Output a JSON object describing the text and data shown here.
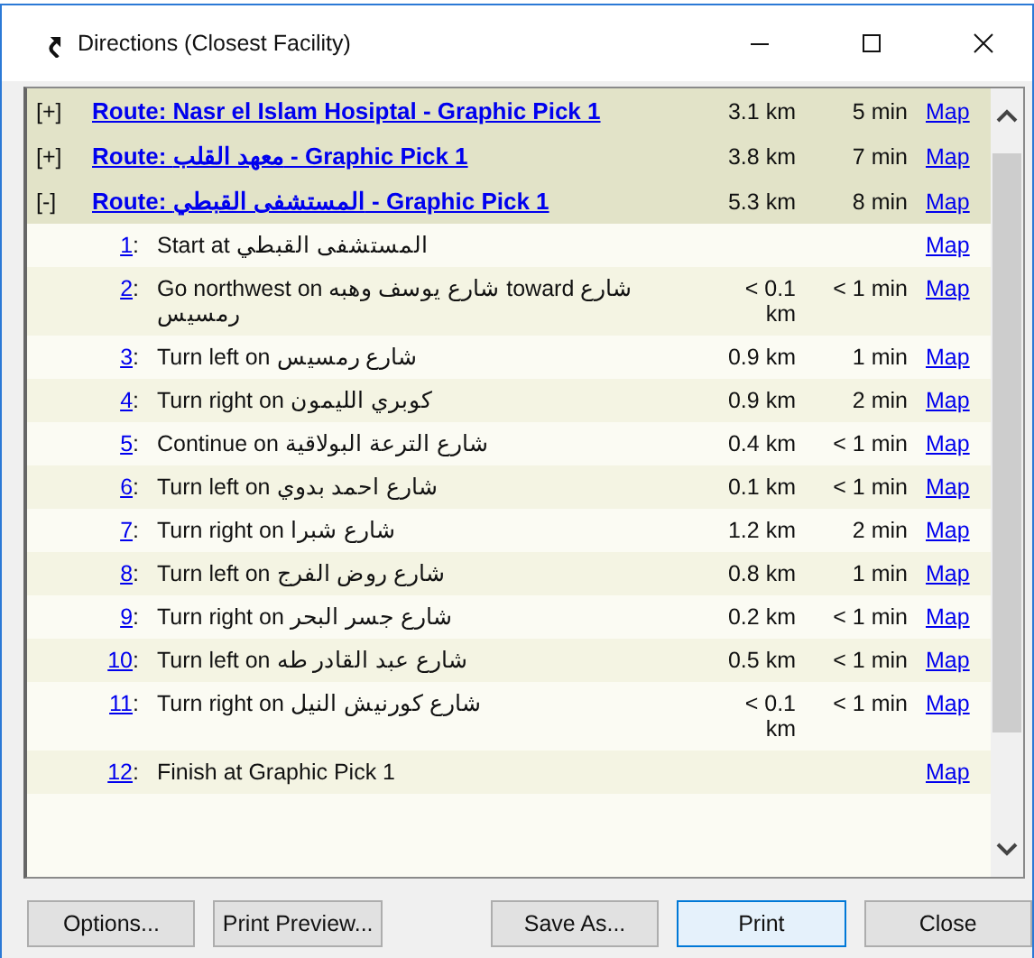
{
  "window": {
    "title": "Directions (Closest Facility)"
  },
  "routes": [
    {
      "toggle": "[+]",
      "title": "Route: Nasr el Islam Hosiptal - Graphic Pick 1",
      "distance": "3.1 km",
      "time": "5 min",
      "map": "Map"
    },
    {
      "toggle": "[+]",
      "title": "Route: معهد القلب - Graphic Pick 1",
      "distance": "3.8 km",
      "time": "7 min",
      "map": "Map"
    },
    {
      "toggle": "[-]",
      "title": "Route: المستشفى القبطي - Graphic Pick 1",
      "distance": "5.3 km",
      "time": "8 min",
      "map": "Map",
      "steps": [
        {
          "number": "1",
          "separator": ":",
          "text": "Start at المستشفى القبطي",
          "map": "Map"
        },
        {
          "number": "2",
          "separator": ":",
          "text": "Go northwest on شارع يوسف وهبه toward شارع رمسيس",
          "distance": "< 0.1 km",
          "time": "< 1 min",
          "map": "Map"
        },
        {
          "number": "3",
          "separator": ":",
          "text": "Turn left on شارع رمسيس",
          "distance": "0.9 km",
          "time": "1 min",
          "map": "Map"
        },
        {
          "number": "4",
          "separator": ":",
          "text": "Turn right on كوبري الليمون",
          "distance": "0.9 km",
          "time": "2 min",
          "map": "Map"
        },
        {
          "number": "5",
          "separator": ":",
          "text": "Continue on شارع الترعة البولاقية",
          "distance": "0.4 km",
          "time": "< 1 min",
          "map": "Map"
        },
        {
          "number": "6",
          "separator": ":",
          "text": "Turn left on شارع احمد بدوي",
          "distance": "0.1 km",
          "time": "< 1 min",
          "map": "Map"
        },
        {
          "number": "7",
          "separator": ":",
          "text": "Turn right on شارع شبرا",
          "distance": "1.2 km",
          "time": "2 min",
          "map": "Map"
        },
        {
          "number": "8",
          "separator": ":",
          "text": "Turn left on شارع روض الفرج",
          "distance": "0.8 km",
          "time": "1 min",
          "map": "Map"
        },
        {
          "number": "9",
          "separator": ":",
          "text": "Turn right on شارع جسر البحر",
          "distance": "0.2 km",
          "time": "< 1 min",
          "map": "Map"
        },
        {
          "number": "10",
          "separator": ":",
          "text": "Turn left on شارع عبد القادر طه",
          "distance": "0.5 km",
          "time": "< 1 min",
          "map": "Map"
        },
        {
          "number": "11",
          "separator": ":",
          "text": "Turn right on شارع كورنيش النيل",
          "distance": "< 0.1 km",
          "time": "< 1 min",
          "map": "Map"
        },
        {
          "number": "12",
          "separator": ":",
          "text": "Finish at Graphic Pick 1",
          "map": "Map"
        }
      ]
    }
  ],
  "buttons": [
    {
      "label": "Options...",
      "default": false
    },
    {
      "label": "Print Preview...",
      "default": false
    },
    {
      "label": "Save As...",
      "default": false
    },
    {
      "label": "Print",
      "default": true
    },
    {
      "label": "Close",
      "default": false
    }
  ]
}
